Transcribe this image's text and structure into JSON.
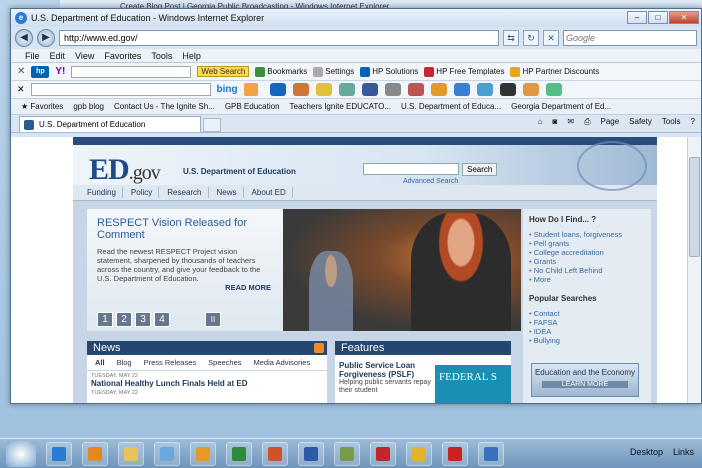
{
  "bg_window": {
    "title": "Create Blog Post | Georgia Public Broadcasting - Windows Internet Explorer"
  },
  "window": {
    "title": "U.S. Department of Education - Windows Internet Explorer",
    "controls": {
      "minimize": "–",
      "maximize": "□",
      "close": "✕"
    }
  },
  "address": {
    "url": "http://www.ed.gov/",
    "search_placeholder": "Google"
  },
  "menu": [
    "File",
    "Edit",
    "View",
    "Favorites",
    "Tools",
    "Help"
  ],
  "toolbar": {
    "hp": "hp",
    "yahoo": "Y!",
    "web_search": "Web Search",
    "bookmarks": "Bookmarks",
    "settings": "Settings",
    "hp_solutions": "HP Solutions",
    "hp_templates": "HP Free Templates",
    "hp_discounts": "HP Partner Discounts"
  },
  "bing": {
    "label": "bing"
  },
  "favorites": {
    "label": "Favorites",
    "items": [
      "gpb blog",
      "Contact Us - The Ignite Sh...",
      "GPB Education",
      "Teachers Ignite EDUCATO...",
      "U.S. Department of Educa...",
      "Georgia Department of Ed..."
    ]
  },
  "tab": {
    "title": "U.S. Department of Education"
  },
  "cmdbar": [
    "Page",
    "Safety",
    "Tools"
  ],
  "site": {
    "logo": "ED",
    "logo_suffix": ".gov",
    "name": "U.S. Department of Education",
    "search_button": "Search",
    "advanced_search": "Advanced Search",
    "nav": [
      "Funding",
      "Policy",
      "Research",
      "News",
      "About ED"
    ],
    "hero": {
      "title": "RESPECT Vision Released for Comment",
      "body": "Read the newest RESPECT Project vision statement, sharpened by thousands of teachers across the country, and give your feedback to the U.S. Department of Education.",
      "more": "READ MORE",
      "pages": [
        "1",
        "2",
        "3",
        "4"
      ],
      "pause": "II"
    },
    "sidebar": {
      "find_title": "How Do I Find... ?",
      "find_items": [
        "Student loans, forgiveness",
        "Pell grants",
        "College accreditation",
        "Grants",
        "No Child Left Behind",
        "More"
      ],
      "popular_title": "Popular Searches",
      "popular_items": [
        "Contact",
        "FAFSA",
        "IDEA",
        "Bullying"
      ],
      "promo_title": "Education and the Economy",
      "promo_button": "LEARN MORE"
    },
    "news": {
      "title": "News",
      "tabs": [
        "All",
        "Blog",
        "Press Releases",
        "Speeches",
        "Media Advisories"
      ],
      "date": "TUESDAY, MAY 22",
      "headline": "National Healthy Lunch Finals Held at ED",
      "date2": "TUESDAY, MAY 22"
    },
    "features": {
      "title": "Features",
      "item_title": "Public Service Loan Forgiveness (PSLF)",
      "item_body": "Helping public servants repay their student",
      "image_text": "FEDERAL S"
    }
  },
  "taskbar": {
    "desktop": "Desktop",
    "links": "Links"
  }
}
